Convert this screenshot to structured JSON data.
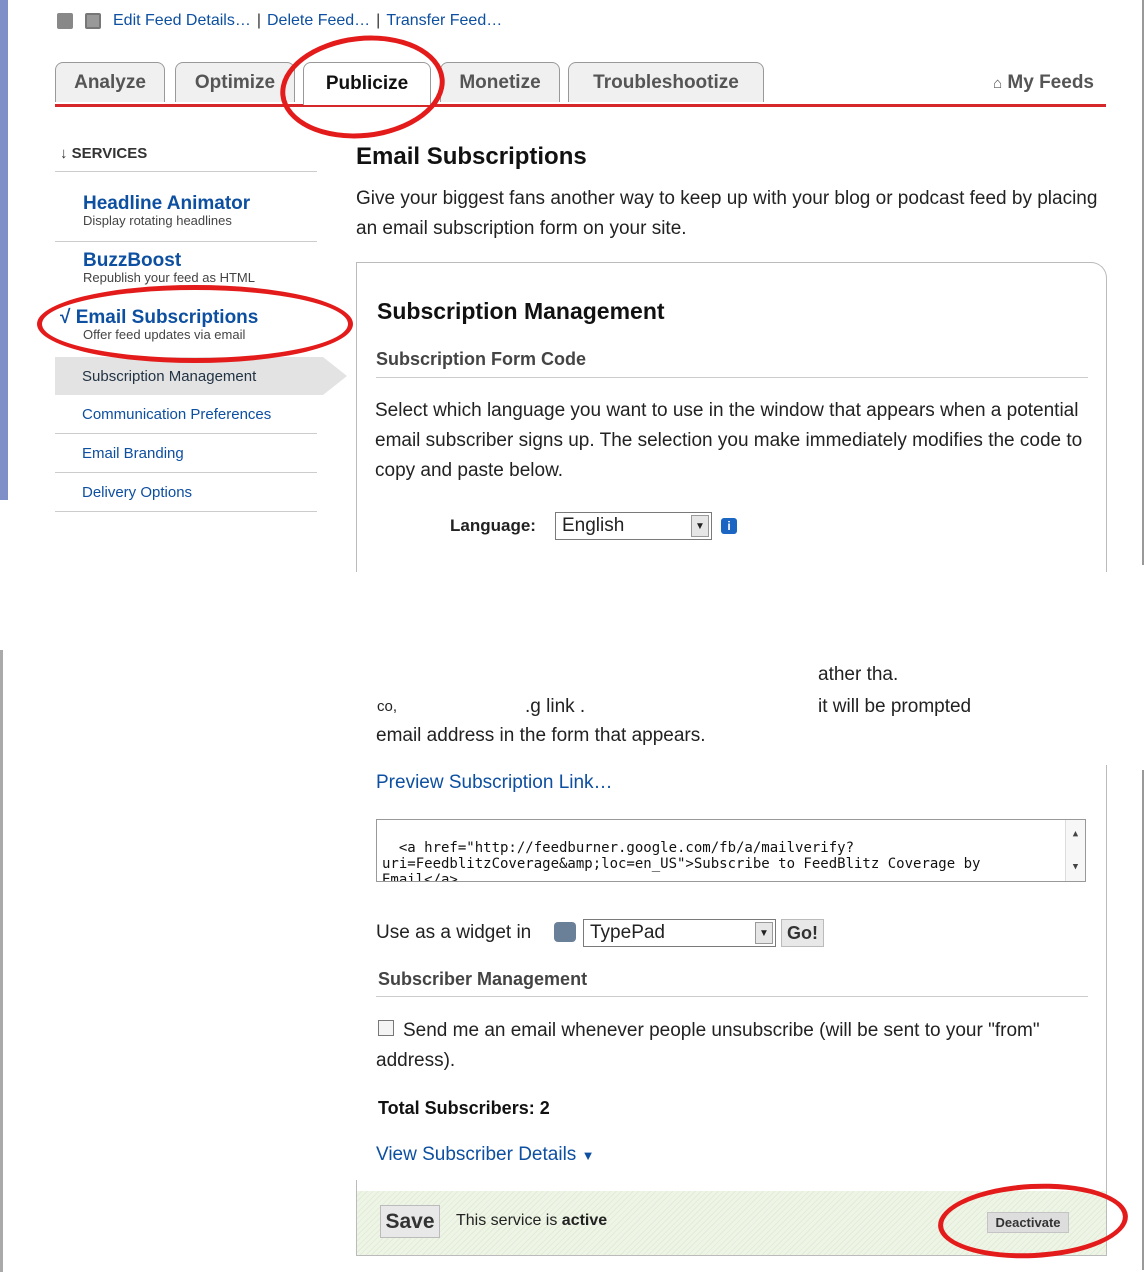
{
  "top_links": {
    "edit": "Edit Feed Details…",
    "delete": "Delete Feed…",
    "transfer": "Transfer Feed…",
    "sep": "|"
  },
  "tabs": [
    {
      "label": "Analyze"
    },
    {
      "label": "Optimize"
    },
    {
      "label": "Publicize"
    },
    {
      "label": "Monetize"
    },
    {
      "label": "Troubleshootize"
    }
  ],
  "my_feeds": "My Feeds",
  "sidebar": {
    "heading": "↓ SERVICES",
    "services": [
      {
        "title": "Headline Animator",
        "desc": "Display rotating headlines"
      },
      {
        "title": "BuzzBoost",
        "desc": "Republish your feed as HTML"
      },
      {
        "title": "√ Email Subscriptions",
        "desc": "Offer feed updates via email"
      }
    ],
    "subitems": [
      {
        "label": "Subscription Management"
      },
      {
        "label": "Communication Preferences"
      },
      {
        "label": "Email Branding"
      },
      {
        "label": "Delivery Options"
      }
    ]
  },
  "main": {
    "title": "Email Subscriptions",
    "intro": "Give your biggest fans another way to keep up with your blog or podcast feed by placing an email subscription form on your site.",
    "card_title": "Subscription Management",
    "form_code_heading": "Subscription Form Code",
    "lang_text": "Select which language you want to use in the window that appears when a potential email subscriber signs up. The selection you make immediately modifies the code to copy and paste below.",
    "language_label": "Language:",
    "language_value": "English",
    "partial_1": "ather tha.",
    "partial_2a": "co,",
    "partial_2b": ".g link .",
    "partial_2c": "it will be prompted",
    "partial_3": "email address in the form that appears.",
    "preview_link": "Preview Subscription Link…",
    "code": "<a href=\"http://feedburner.google.com/fb/a/mailverify?uri=FeedblitzCoverage&amp;loc=en_US\">Subscribe to FeedBlitz Coverage by Email</a>",
    "widget_label": "Use as a widget in",
    "widget_value": "TypePad",
    "go": "Go!",
    "subscriber_heading": "Subscriber Management",
    "unsub_text": "Send me an email whenever people unsubscribe (will be sent to your \"from\" address).",
    "total": "Total Subscribers: 2",
    "details_link": "View Subscriber Details",
    "save": "Save",
    "status_prefix": "This service is ",
    "status_value": "active",
    "deactivate": "Deactivate"
  },
  "colors": {
    "accent_red": "#d6282b",
    "link_blue": "#0d4fa0",
    "annotation_red": "#e41b1b"
  }
}
